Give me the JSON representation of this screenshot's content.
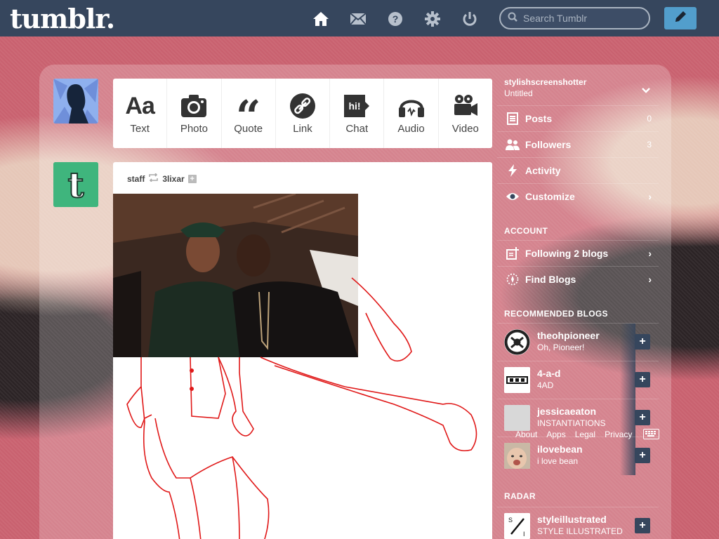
{
  "header": {
    "logo": "tumblr.",
    "search_placeholder": "Search Tumblr",
    "icons": [
      "home-icon",
      "mail-icon",
      "help-icon",
      "gear-icon",
      "power-icon"
    ],
    "compose_icon": "pencil-icon"
  },
  "post_types": [
    {
      "label": "Text",
      "icon": "text-icon"
    },
    {
      "label": "Photo",
      "icon": "camera-icon"
    },
    {
      "label": "Quote",
      "icon": "quote-icon"
    },
    {
      "label": "Link",
      "icon": "link-icon"
    },
    {
      "label": "Chat",
      "icon": "chat-icon"
    },
    {
      "label": "Audio",
      "icon": "headphones-icon"
    },
    {
      "label": "Video",
      "icon": "video-camera-icon"
    }
  ],
  "post": {
    "author": "staff",
    "reblogged_from": "3lixar"
  },
  "sidebar": {
    "blog_name": "stylishscreenshotter",
    "blog_title": "Untitled",
    "items": [
      {
        "label": "Posts",
        "count": "0"
      },
      {
        "label": "Followers",
        "count": "3"
      },
      {
        "label": "Activity",
        "count": ""
      },
      {
        "label": "Customize",
        "count": ""
      }
    ],
    "account_heading": "ACCOUNT",
    "account_items": [
      {
        "label": "Following 2 blogs"
      },
      {
        "label": "Find Blogs"
      }
    ],
    "recommended_heading": "RECOMMENDED BLOGS",
    "recommended": [
      {
        "name": "theohpioneer",
        "title": "Oh, Pioneer!"
      },
      {
        "name": "4-a-d",
        "title": "4AD"
      },
      {
        "name": "jessicaeaton",
        "title": "INSTANTIATIONS"
      },
      {
        "name": "ilovebean",
        "title": "i love bean"
      }
    ],
    "radar_heading": "RADAR",
    "radar": {
      "name": "styleillustrated",
      "title": "STYLE ILLUSTRATED"
    }
  },
  "footer": {
    "links": [
      "About",
      "Apps",
      "Legal",
      "Privacy"
    ]
  }
}
